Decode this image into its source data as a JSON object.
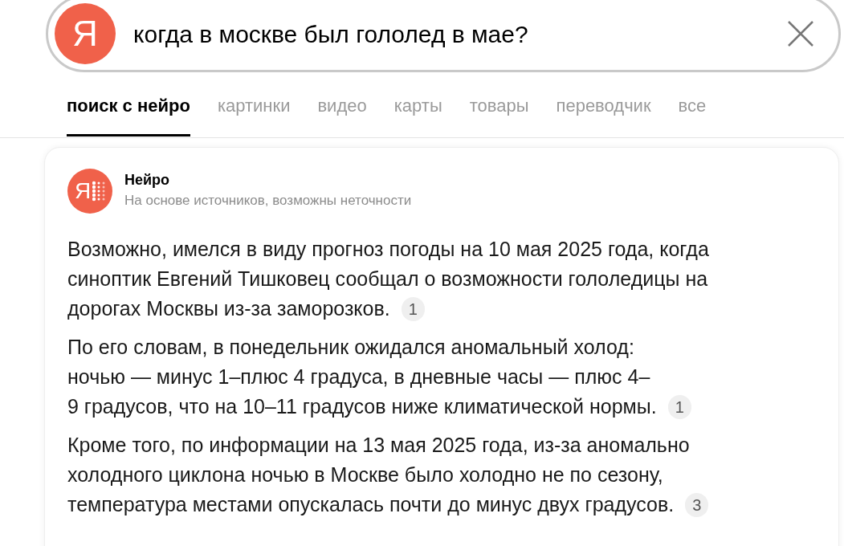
{
  "search": {
    "logo": "Я",
    "query": "когда в москве был гололед в мае?"
  },
  "tabs": [
    {
      "label": "поиск с нейро",
      "selected": true
    },
    {
      "label": "картинки",
      "selected": false
    },
    {
      "label": "видео",
      "selected": false
    },
    {
      "label": "карты",
      "selected": false
    },
    {
      "label": "товары",
      "selected": false
    },
    {
      "label": "переводчик",
      "selected": false
    },
    {
      "label": "все",
      "selected": false
    }
  ],
  "answer": {
    "logo": "Я",
    "title": "Нейро",
    "subtitle": "На основе источников, возможны неточности",
    "paragraphs": [
      {
        "lines": [
          "Возможно, имелся в виду прогноз погоды на 10 мая 2025 года, когда",
          "синоптик Евгений Тишковец сообщал о возможности гололедицы на",
          "дорогах Москвы из-за заморозков."
        ],
        "citation": "1"
      },
      {
        "lines": [
          "По его словам, в понедельник ожидался аномальный холод:",
          "ночью — минус 1–плюс 4 градуса, в дневные часы — плюс 4–",
          "9 градусов, что на 10–11 градусов ниже климатической нормы."
        ],
        "citation": "1"
      },
      {
        "lines": [
          "Кроме того, по информации на 13 мая 2025 года, из-за аномально",
          "холодного циклона ночью в Москве было холодно не по сезону,",
          "температура местами опускалась почти до минус двух градусов."
        ],
        "citation": "3"
      }
    ]
  }
}
